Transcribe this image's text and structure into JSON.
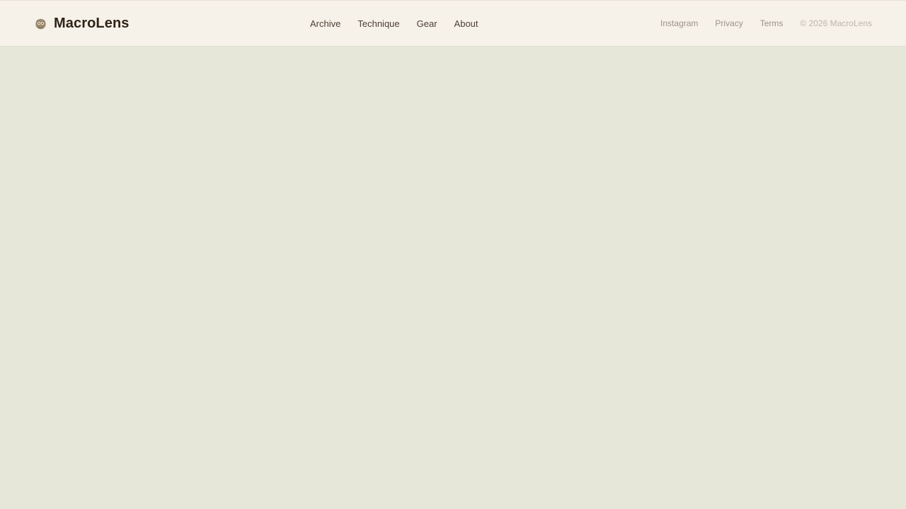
{
  "brand": {
    "name": "MacroLens",
    "icon": "owl-icon"
  },
  "nav": {
    "items": [
      {
        "label": "Archive"
      },
      {
        "label": "Technique"
      },
      {
        "label": "Gear"
      },
      {
        "label": "About"
      }
    ]
  },
  "aux": {
    "links": [
      {
        "label": "Instagram"
      },
      {
        "label": "Privacy"
      },
      {
        "label": "Terms"
      }
    ],
    "copyright": "© 2026 MacroLens"
  },
  "colors": {
    "header_bg": "#f6f1e9",
    "page_bg": "#e7e7d9",
    "brand_text": "#2f2418",
    "nav_text": "#4c3f33",
    "muted_text": "#9c9287"
  }
}
